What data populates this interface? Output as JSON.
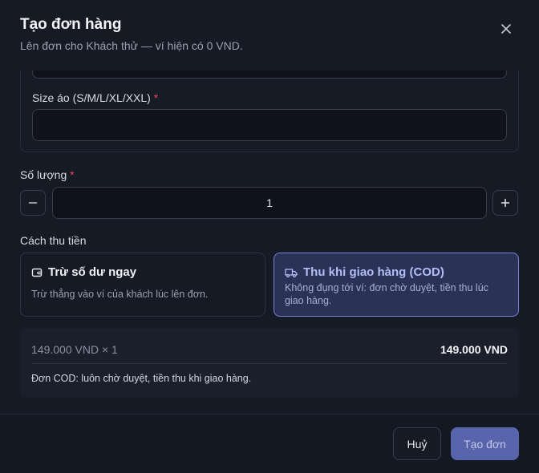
{
  "dialog": {
    "title": "Tạo đơn hàng",
    "subtitle": "Lên đơn cho Khách thử — ví hiện có 0 VND."
  },
  "form": {
    "size_label": "Size áo (S/M/L/XL/XXL)",
    "size_value": "",
    "quantity_label": "Số lượng",
    "quantity_value": "1",
    "required_mark": "*",
    "payment_label": "Cách thu tiền",
    "payment_options": [
      {
        "title": "Trừ số dư ngay",
        "description": "Trừ thẳng vào ví của khách lúc lên đơn.",
        "icon": "wallet-icon",
        "selected": false
      },
      {
        "title": "Thu khi giao hàng (COD)",
        "description": "Không đụng tới ví: đơn chờ duyệt, tiền thu lúc giao hàng.",
        "icon": "truck-icon",
        "selected": true
      }
    ]
  },
  "summary": {
    "line_item": "149.000 VND × 1",
    "total": "149.000 VND",
    "note": "Đơn COD: luôn chờ duyệt, tiền thu khi giao hàng."
  },
  "footer": {
    "cancel_label": "Huỷ",
    "submit_label": "Tạo đơn"
  },
  "colors": {
    "background": "#161a24",
    "selected_border": "#7583d8",
    "selected_bg": "#2b3257",
    "primary_button": "#5865ad",
    "required": "#e5485a"
  }
}
